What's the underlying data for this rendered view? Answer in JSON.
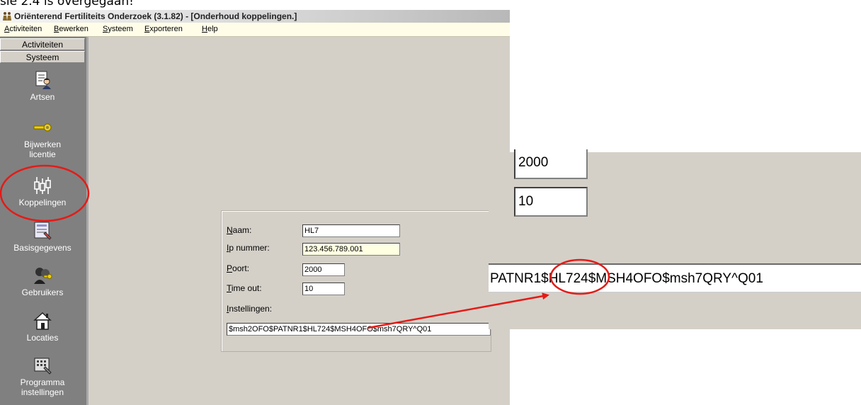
{
  "document": {
    "caption": "sie 2.4 is overgegaan!"
  },
  "window": {
    "title": "Oriënterend Fertiliteits Onderzoek (3.1.82) - [Onderhoud koppelingen.]"
  },
  "menu": [
    {
      "label": "Activiteiten"
    },
    {
      "label": "Bewerken"
    },
    {
      "label": "Systeem"
    },
    {
      "label": "Exporteren"
    },
    {
      "label": "Help"
    }
  ],
  "sidebar": {
    "groups": [
      "Activiteiten",
      "Systeem"
    ],
    "items": [
      {
        "label": "Artsen",
        "icon": "doctor-document-icon"
      },
      {
        "label": "Bijwerken\nlicentie",
        "icon": "key-icon"
      },
      {
        "label": "Koppelingen",
        "icon": "connector-icon"
      },
      {
        "label": "Basisgegevens",
        "icon": "data-form-icon"
      },
      {
        "label": "Gebruikers",
        "icon": "users-key-icon"
      },
      {
        "label": "Locaties",
        "icon": "house-icon"
      },
      {
        "label": "Programma\ninstellingen",
        "icon": "settings-keyboard-icon"
      }
    ]
  },
  "form": {
    "naam_label": "Naam:",
    "naam_value": "HL7",
    "ip_label": "Ip nummer:",
    "ip_value": "123.456.789.001",
    "poort_label": "Poort:",
    "poort_value": "2000",
    "timeout_label": "Time out:",
    "timeout_value": "10",
    "instellingen_label": "Instellingen:",
    "instellingen_value": "$msh2OFO$PATNR1$HL724$MSH4OFO$msh7QRY^Q01"
  },
  "zoom": {
    "poort_value": "2000",
    "timeout_value": "10",
    "instellingen_value": "PATNR1$HL724$MSH4OFO$msh7QRY^Q01"
  },
  "annotation_colors": {
    "highlight": "#e41b17"
  }
}
